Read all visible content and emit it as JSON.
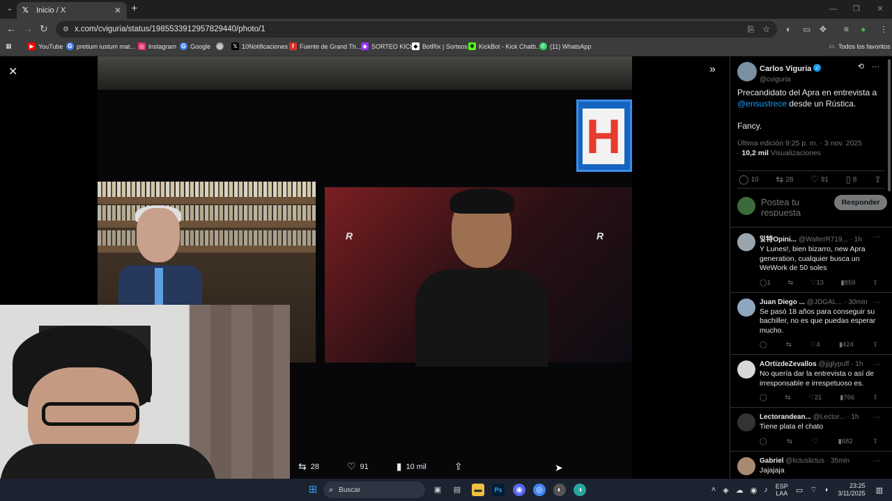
{
  "browser": {
    "tab_title": "Inicio / X",
    "url": "x.com/cviguria/status/1985533912957829440/photo/1",
    "bookmarks": [
      {
        "label": "YouTube",
        "icon": "youtube-icon",
        "color": "#ff0000"
      },
      {
        "label": "pretium iustum mat...",
        "icon": "google-icon",
        "color": "#4285f4"
      },
      {
        "label": "Instagram",
        "icon": "instagram-icon",
        "color": "#e1306c"
      },
      {
        "label": "Google",
        "icon": "google-icon",
        "color": "#4285f4"
      },
      {
        "label": "",
        "icon": "globe-icon",
        "color": "#9aa0a6"
      },
      {
        "label": "10Notificaciones",
        "icon": "x-icon",
        "color": "#000000"
      },
      {
        "label": "Fuente de Grand Th...",
        "icon": "font-icon",
        "color": "#d93025"
      },
      {
        "label": "SORTEO KICK",
        "icon": "kick-icon",
        "color": "#9b30ff"
      },
      {
        "label": "BotRix | Sorteos",
        "icon": "botrix-icon",
        "color": "#ffffff"
      },
      {
        "label": "KickBot - Kick Chatb...",
        "icon": "kickbot-icon",
        "color": "#53fc18"
      },
      {
        "label": "(11) WhatsApp",
        "icon": "whatsapp-icon",
        "color": "#25d366"
      }
    ],
    "all_bookmarks": "Todos los favoritos"
  },
  "photo_actions": {
    "retweets": "28",
    "likes": "91",
    "views": "10 mil"
  },
  "tweet": {
    "author_name": "Carlos Viguria",
    "author_handle": "@cviguria",
    "text_1": "Precandidato del Apra en entrevista a",
    "mention": "@ensustrece",
    "text_2": " desde un Rústica.",
    "text_3": "Fancy.",
    "edited": "Última edición 9:25 p. m. · 3 nov. 2025",
    "views_count": "10,2 mil",
    "views_label": "Visualizaciones",
    "stats": {
      "replies": "10",
      "retweets": "28",
      "likes": "91",
      "bookmarks": "8"
    },
    "reply_placeholder": "Postea tu respuesta",
    "reply_button": "Responder"
  },
  "replies": [
    {
      "name": "잋特Opini...",
      "handle": "@WalterR719...",
      "time": "1h",
      "text": "Y Lunes!, bien bizarro, new Apra generation, cualquier busca un WeWork de 50 soles",
      "replies": "1",
      "retweets": "",
      "likes": "13",
      "views": "859"
    },
    {
      "name": "Juan Diego ...",
      "handle": "@JDGAL...",
      "time": "30min",
      "text": "Se pasó 18 años para conseguir su bachiller, no es que puedas esperar mucho.",
      "replies": "",
      "retweets": "",
      "likes": "4",
      "views": "424"
    },
    {
      "name": "AOrtizdeZevallos",
      "handle": "@jjglypuff",
      "time": "1h",
      "text": "No quería dar la entrevista o así de irresponsable e irrespetuoso es.",
      "replies": "",
      "retweets": "",
      "likes": "21",
      "views": "766"
    },
    {
      "name": "Lectorandean...",
      "handle": "@Lector...",
      "time": "1h",
      "text": "Tiene plata el chato",
      "replies": "",
      "retweets": "",
      "likes": "",
      "views": "682"
    },
    {
      "name": "Gabriel",
      "handle": "@lictuslictus",
      "time": "35min",
      "text": "Jajajaja",
      "replies": "",
      "retweets": "",
      "likes": "",
      "views": ""
    }
  ],
  "taskbar": {
    "search_placeholder": "Buscar",
    "lang_1": "ESP",
    "lang_2": "LAA",
    "time": "23:25",
    "date": "3/11/2025"
  }
}
